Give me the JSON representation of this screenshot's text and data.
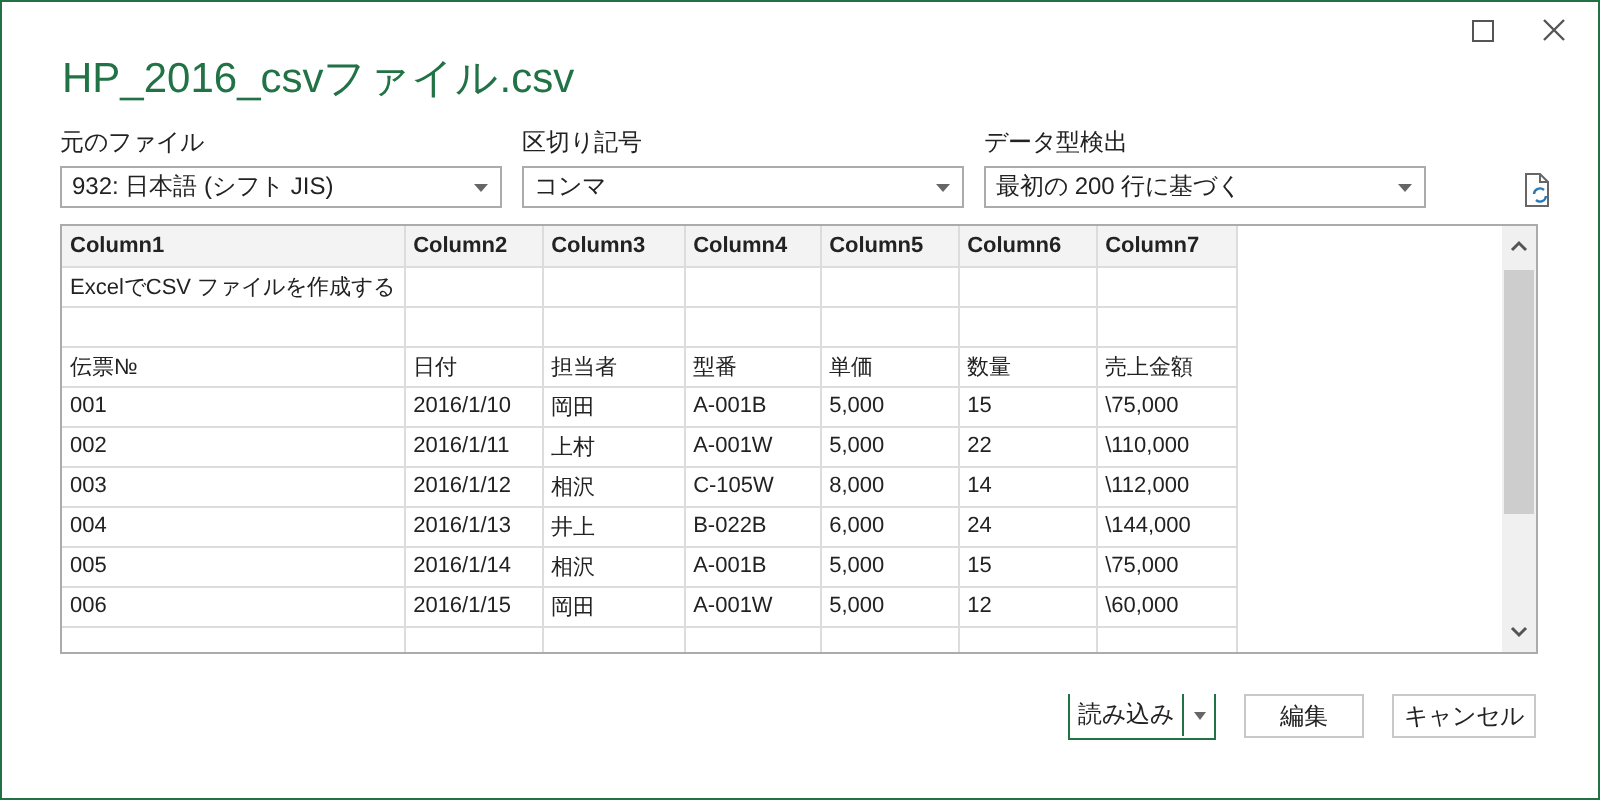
{
  "window": {
    "title": "HP_2016_csvファイル.csv"
  },
  "fields": [
    {
      "label": "元のファイル",
      "value": "932: 日本語 (シフト JIS)"
    },
    {
      "label": "区切り記号",
      "value": "コンマ"
    },
    {
      "label": "データ型検出",
      "value": "最初の 200 行に基づく"
    }
  ],
  "table": {
    "columns": [
      "Column1",
      "Column2",
      "Column3",
      "Column4",
      "Column5",
      "Column6",
      "Column7"
    ],
    "rows": [
      {
        "kind": "data",
        "cells": [
          "ExcelでCSV ファイルを作成する"
        ]
      },
      {
        "kind": "blank"
      },
      {
        "kind": "data",
        "cells": [
          "伝票№",
          "日付",
          "担当者",
          "型番",
          "単価",
          "数量",
          "売上金額"
        ]
      },
      {
        "kind": "data",
        "cells": [
          "001",
          "2016/1/10",
          "岡田",
          "A-001B",
          "5,000",
          "15",
          "\\75,000"
        ]
      },
      {
        "kind": "data",
        "cells": [
          "002",
          "2016/1/11",
          "上村",
          "A-001W",
          "5,000",
          "22",
          "\\110,000"
        ]
      },
      {
        "kind": "data",
        "cells": [
          "003",
          "2016/1/12",
          "相沢",
          "C-105W",
          "8,000",
          "14",
          "\\112,000"
        ]
      },
      {
        "kind": "data",
        "cells": [
          "004",
          "2016/1/13",
          "井上",
          "B-022B",
          "6,000",
          "24",
          "\\144,000"
        ]
      },
      {
        "kind": "data",
        "cells": [
          "005",
          "2016/1/14",
          "相沢",
          "A-001B",
          "5,000",
          "15",
          "\\75,000"
        ]
      },
      {
        "kind": "data",
        "cells": [
          "006",
          "2016/1/15",
          "岡田",
          "A-001W",
          "5,000",
          "12",
          "\\60,000"
        ]
      }
    ]
  },
  "buttons": [
    {
      "label": "読み込み",
      "kind": "split"
    },
    {
      "label": "編集",
      "kind": "plain"
    },
    {
      "label": "キャンセル",
      "kind": "plain"
    }
  ]
}
